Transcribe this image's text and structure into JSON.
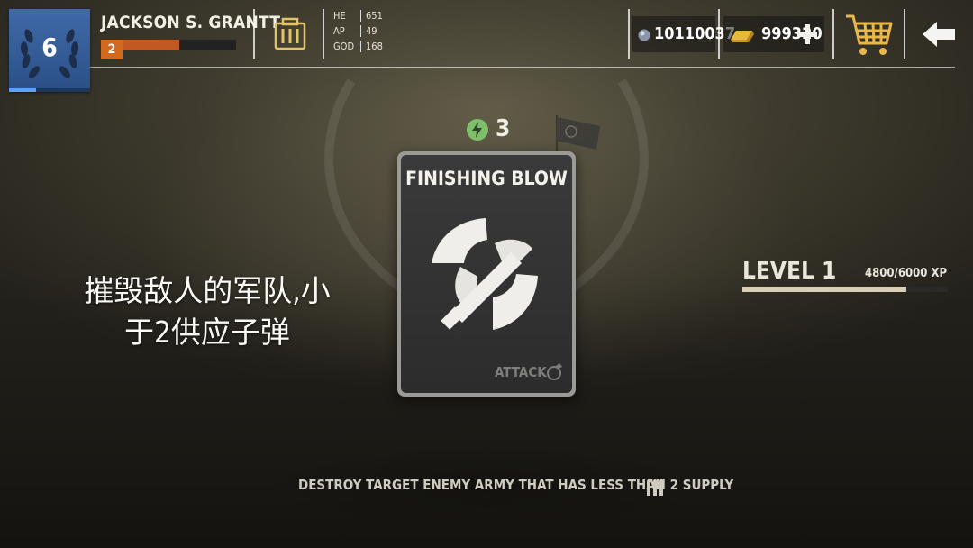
{
  "player": {
    "level": "6",
    "level_progress": 0.33,
    "name": "JACKSON S. GRANTT",
    "rank": "2",
    "rank_progress": 0.5
  },
  "stats": [
    {
      "label": "HE",
      "value": "651"
    },
    {
      "label": "AP",
      "value": "49"
    },
    {
      "label": "GOD",
      "value": "168"
    }
  ],
  "currency": {
    "silver": "10110037",
    "gold": "999320"
  },
  "icons": {
    "ammo": "ammo-crate-icon",
    "silver": "silver-coin-icon",
    "gold": "gold-bar-icon",
    "add": "plus-icon",
    "cart": "shopping-cart-icon",
    "back": "back-arrow-icon",
    "energy": "lightning-icon",
    "card": "battle-axe-icon",
    "supply": "bullets-icon"
  },
  "energy": "3",
  "card": {
    "title": "FINISHING BLOW",
    "type": "ATTACK"
  },
  "description_cn_line1": "摧毁敌人的军队,小",
  "description_cn_line2": "于2供应子弹",
  "level": {
    "label": "LEVEL 1",
    "xp": "4800/6000 XP",
    "progress": 0.8
  },
  "description_en": "DESTROY TARGET ENEMY ARMY THAT HAS LESS THAN 2 SUPPLY",
  "description_en_end": ".",
  "colors": {
    "badge_blue": "#3f6aa8",
    "rank_orange": "#d2691e",
    "energy_green": "#7fbf6a",
    "gold": "#e6c34a"
  }
}
